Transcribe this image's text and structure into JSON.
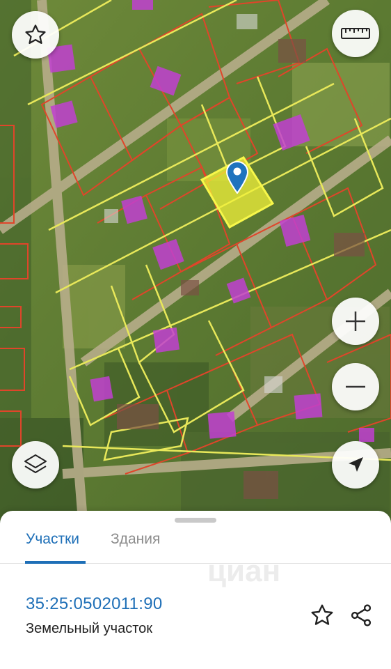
{
  "map": {
    "controls": {
      "favorite_icon": "star-icon",
      "ruler_icon": "ruler-icon",
      "layers_icon": "layers-icon",
      "zoom_in_icon": "plus-icon",
      "zoom_out_icon": "minus-icon",
      "locate_icon": "navigation-arrow-icon"
    },
    "pin_icon": "map-pin-icon",
    "colors": {
      "parcel_border": "#e8e85a",
      "cadastral_border": "#e0452a",
      "building": "#c13fd1",
      "selected_parcel": "#f2f23a",
      "pin": "#1e73be"
    }
  },
  "sheet": {
    "tabs": [
      {
        "label": "Участки",
        "active": true
      },
      {
        "label": "Здания",
        "active": false
      }
    ],
    "parcel": {
      "cadastral_number": "35:25:0502011:90",
      "type": "Земельный участок"
    },
    "watermark": "циан",
    "actions": {
      "favorite_icon": "star-outline-icon",
      "share_icon": "share-icon"
    },
    "colors": {
      "accent": "#1e6fb7"
    }
  }
}
